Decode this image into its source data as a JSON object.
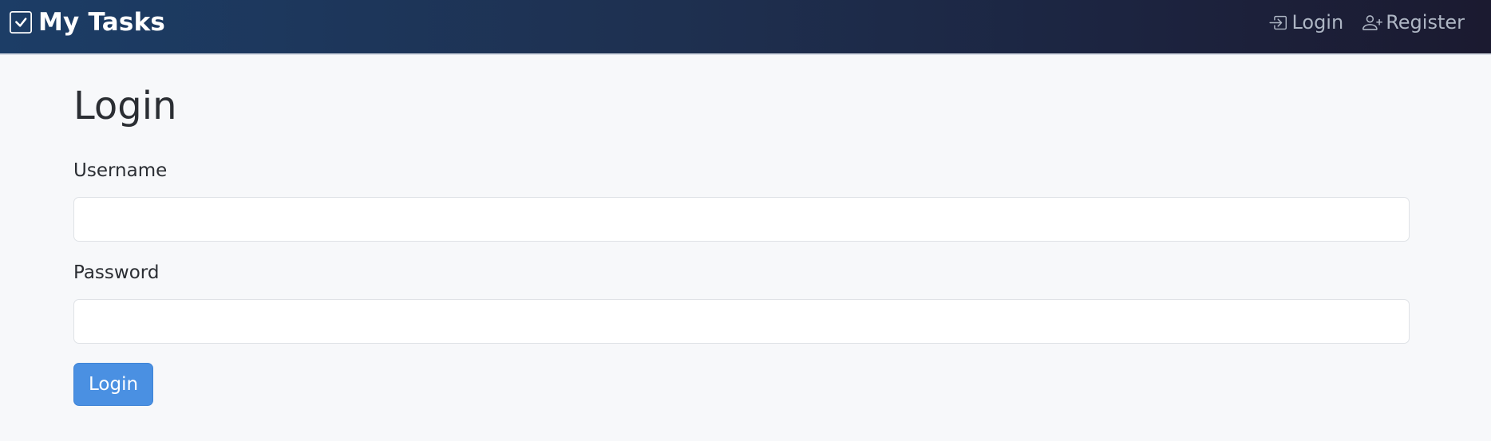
{
  "navbar": {
    "brand": {
      "icon": "check-square-icon",
      "title": "My Tasks"
    },
    "links": [
      {
        "icon": "login-icon",
        "label": "Login"
      },
      {
        "icon": "person-plus-icon",
        "label": "Register"
      }
    ]
  },
  "page": {
    "title": "Login"
  },
  "form": {
    "username_label": "Username",
    "username_value": "",
    "password_label": "Password",
    "password_value": "",
    "submit_label": "Login"
  },
  "colors": {
    "nav_gradient_start": "#1c3d66",
    "nav_gradient_end": "#1b1a30",
    "primary_button": "#4a90e2",
    "page_background": "#f7f8fa"
  }
}
